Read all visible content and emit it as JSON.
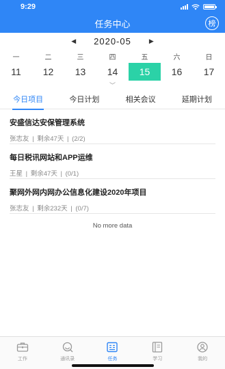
{
  "status": {
    "time": "9:29"
  },
  "header": {
    "title": "任务中心",
    "rank_label": "榜"
  },
  "calendar": {
    "month": "2020-05",
    "weekdays": [
      "一",
      "二",
      "三",
      "四",
      "五",
      "六",
      "日"
    ],
    "days": [
      "11",
      "12",
      "13",
      "14",
      "15",
      "16",
      "17"
    ],
    "selected_day": "15"
  },
  "tabs": [
    "今日项目",
    "今日计划",
    "相关会议",
    "延期计划"
  ],
  "projects": [
    {
      "title": "安盛信达安保管理系统",
      "owner": "张志友",
      "remaining": "剩余47天",
      "progress": "(2/2)"
    },
    {
      "title": "每日税讯网站和APP运维",
      "owner": "王星",
      "remaining": "剩余47天",
      "progress": "(0/1)"
    },
    {
      "title": "聚网外网内网办公信息化建设2020年项目",
      "owner": "张志友",
      "remaining": "剩余232天",
      "progress": "(0/7)"
    }
  ],
  "separator": "|",
  "no_more": "No more data",
  "tabbar": [
    {
      "label": "工作",
      "icon": "briefcase-icon"
    },
    {
      "label": "通讯录",
      "icon": "contacts-icon"
    },
    {
      "label": "任务",
      "icon": "task-icon"
    },
    {
      "label": "学习",
      "icon": "book-icon"
    },
    {
      "label": "我的",
      "icon": "user-icon"
    }
  ],
  "colors": {
    "primary": "#2f86f6",
    "selected_day": "#2bd2a7"
  }
}
